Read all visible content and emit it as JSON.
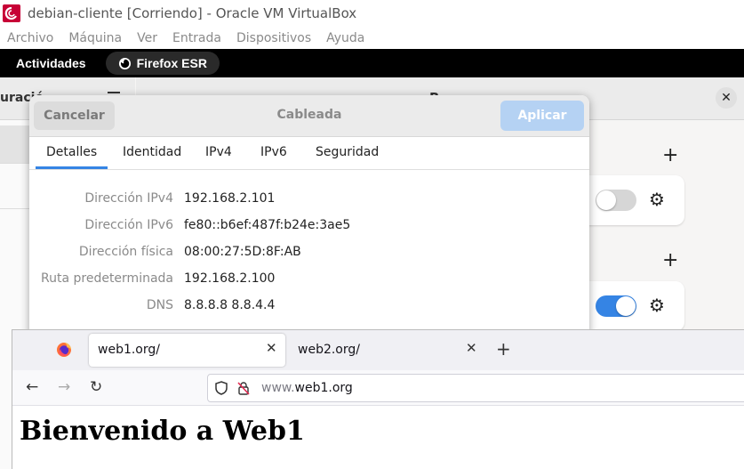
{
  "host": {
    "title": "debian-cliente [Corriendo] - Oracle VM VirtualBox",
    "menu": [
      "Archivo",
      "Máquina",
      "Ver",
      "Entrada",
      "Dispositivos",
      "Ayuda"
    ]
  },
  "gnome": {
    "activities": "Actividades",
    "app": "Firefox ESR"
  },
  "settings": {
    "left_header_fragment": "uració",
    "header_fragment": "R",
    "accent_color": "#3584e4"
  },
  "dialog": {
    "cancel": "Cancelar",
    "title": "Cableada",
    "apply": "Aplicar",
    "tabs": [
      "Detalles",
      "Identidad",
      "IPv4",
      "IPv6",
      "Seguridad"
    ],
    "active_tab": "Detalles",
    "details": [
      {
        "label": "Dirección IPv4",
        "value": "192.168.2.101"
      },
      {
        "label": "Dirección IPv6",
        "value": "fe80::b6ef:487f:b24e:3ae5"
      },
      {
        "label": "Dirección física",
        "value": "08:00:27:5D:8F:AB"
      },
      {
        "label": "Ruta predeterminada",
        "value": "192.168.2.100"
      },
      {
        "label": "DNS",
        "value": "8.8.8.8 8.8.4.4"
      }
    ]
  },
  "firefox": {
    "tabs": [
      {
        "title": "web1.org/",
        "selected": true
      },
      {
        "title": "web2.org/",
        "selected": false
      }
    ],
    "url_prefix": "www.",
    "url_domain": "web1.org",
    "page_heading": "Bienvenido a Web1"
  }
}
